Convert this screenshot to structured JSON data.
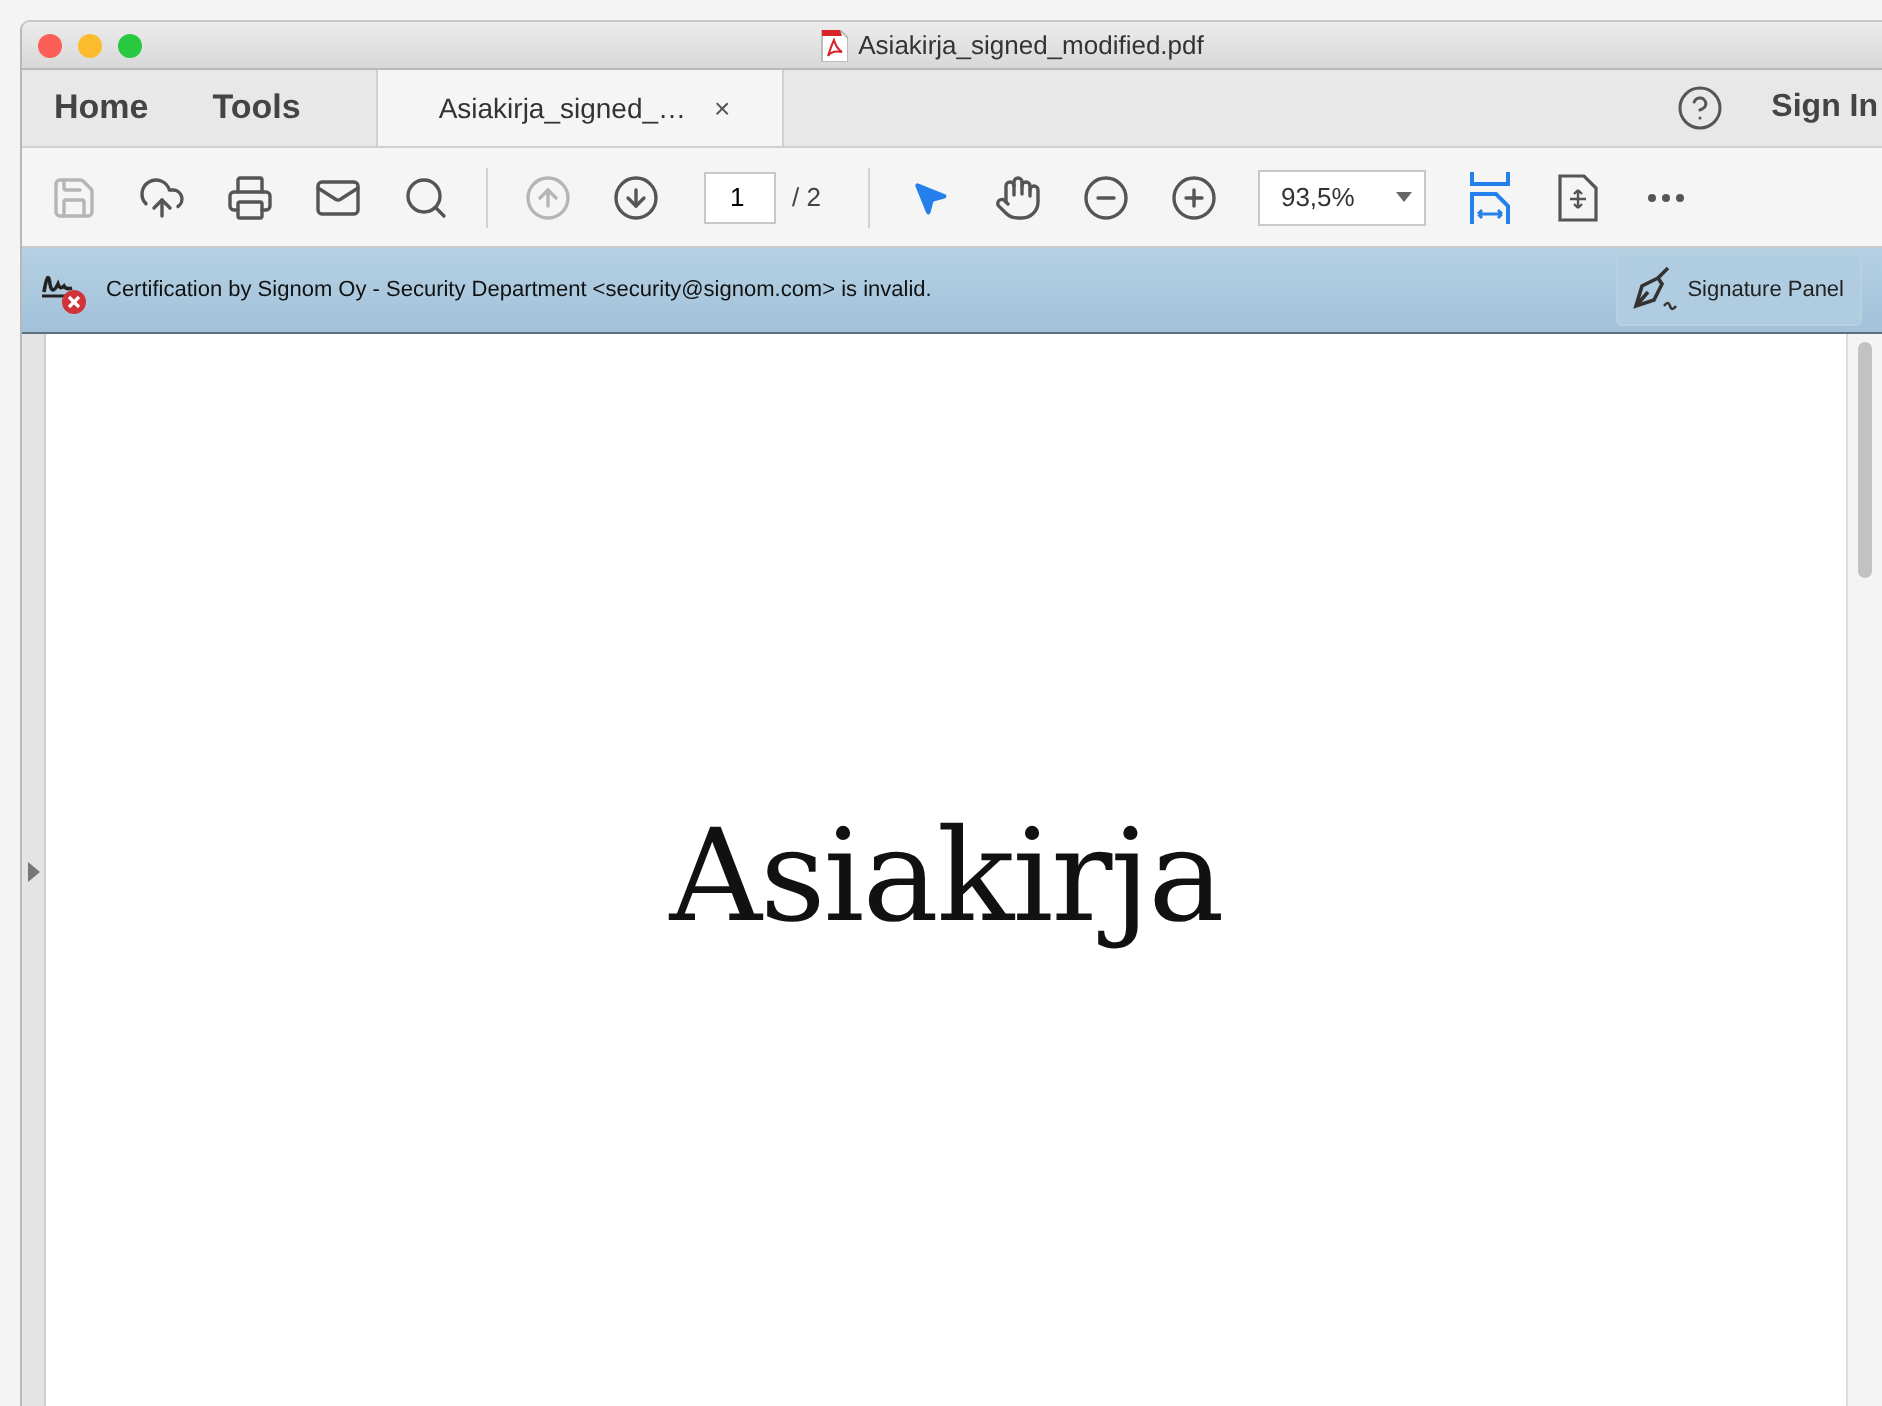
{
  "window": {
    "title": "Asiakirja_signed_modified.pdf"
  },
  "tabs": [
    {
      "label": "Home",
      "selected": false
    },
    {
      "label": "Tools",
      "selected": false
    },
    {
      "label": "Asiakirja_signed_…",
      "selected": true,
      "close": "×"
    }
  ],
  "header_right": {
    "sign_in": "Sign In"
  },
  "toolbar": [
    {
      "kind": "save",
      "disabled": true
    },
    {
      "kind": "upload",
      "disabled": false
    },
    {
      "kind": "print",
      "disabled": false
    },
    {
      "kind": "mail",
      "disabled": false
    },
    {
      "kind": "search",
      "disabled": false
    },
    {
      "kind": "separator"
    },
    {
      "kind": "prev",
      "disabled": true
    },
    {
      "kind": "next",
      "disabled": false
    },
    {
      "kind": "page",
      "value": "1",
      "total": "/ 2"
    },
    {
      "kind": "separator"
    },
    {
      "kind": "select",
      "selected": true
    },
    {
      "kind": "hand",
      "selected": false
    },
    {
      "kind": "zoom-out",
      "disabled": false
    },
    {
      "kind": "zoom-in",
      "disabled": false
    },
    {
      "kind": "zoom",
      "value": "93,5%"
    },
    {
      "kind": "fit-width",
      "selected": true
    },
    {
      "kind": "fit-page",
      "selected": false
    },
    {
      "kind": "more",
      "disabled": false
    }
  ],
  "signature_bar": {
    "message": "Certification by Signom Oy - Security Department <security@signom.com> is invalid.",
    "button": "Signature Panel"
  },
  "document": {
    "heading": "Asiakirja"
  }
}
